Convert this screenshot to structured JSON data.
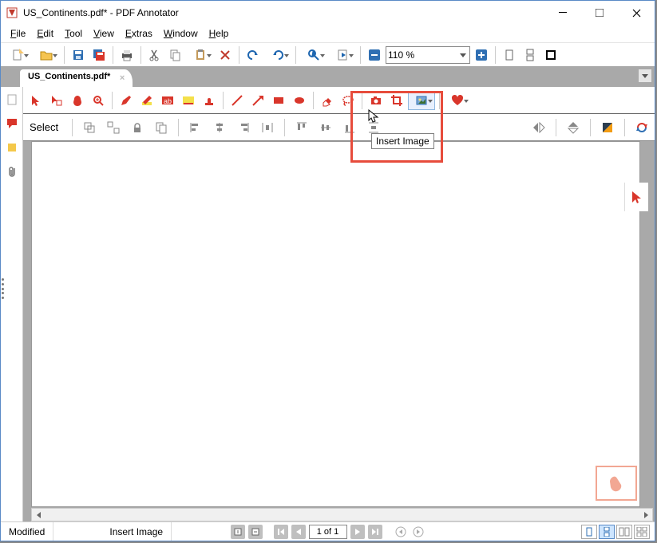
{
  "window": {
    "title": "US_Continents.pdf* - PDF Annotator"
  },
  "menu": {
    "file": "File",
    "edit": "Edit",
    "tool": "Tool",
    "view": "View",
    "extras": "Extras",
    "window": "Window",
    "help": "Help"
  },
  "toolbar": {
    "zoom": "110 %"
  },
  "tabs": {
    "active": "US_Continents.pdf*"
  },
  "subtoolbar": {
    "mode_label": "Select"
  },
  "tooltip": {
    "insert_image": "Insert Image"
  },
  "status": {
    "left": "Modified",
    "tool": "Insert Image",
    "page": "1 of 1"
  }
}
